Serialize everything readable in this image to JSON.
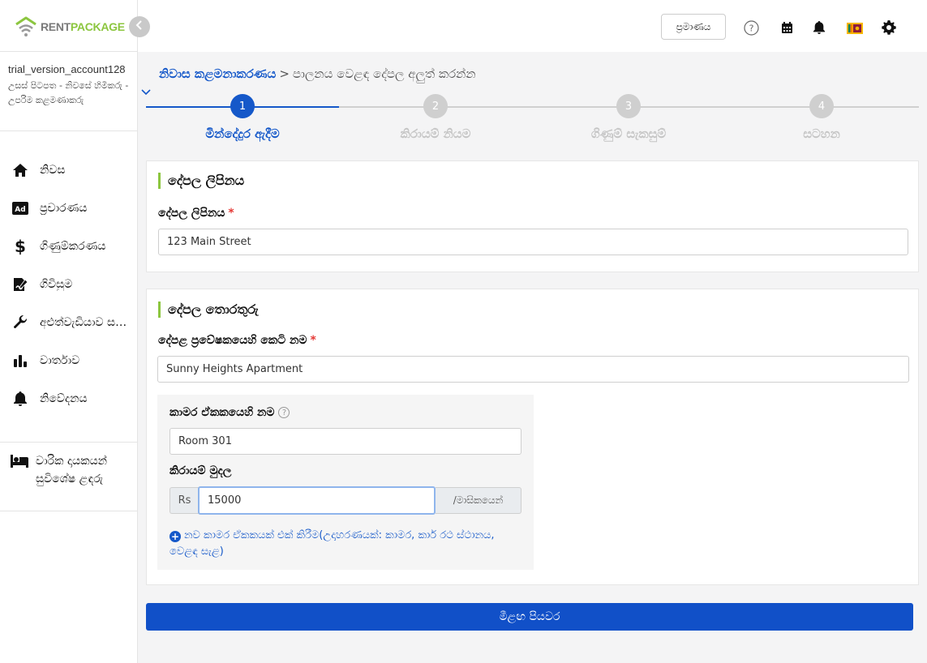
{
  "brand": {
    "rent": "RENT",
    "package": "PACKAGE",
    "accent": "#8cc63f",
    "primary": "#1558c9"
  },
  "header": {
    "auth_label": "ප්‍රමාණය",
    "icons": [
      "help-icon",
      "calendar-icon",
      "bell-icon",
      "flag-icon",
      "gear-icon"
    ]
  },
  "account": {
    "name": "trial_version_account128",
    "role": "උසස් පිටපත - නිවසේ හිමිකරු - උපරිම කළමණාකරු"
  },
  "sidebar": {
    "items": [
      {
        "label": "නිවස",
        "icon": "home-icon"
      },
      {
        "label": "ප්‍රචාරණය",
        "icon": "ad-icon"
      },
      {
        "label": "ගිණුම්කරණය",
        "icon": "dollar-icon"
      },
      {
        "label": "ගිවිසුම",
        "icon": "contract-icon"
      },
      {
        "label": "අළුත්වැඩියාව සහ නඩත්තුව",
        "icon": "wrench-icon"
      },
      {
        "label": "වාර්තාව",
        "icon": "chart-icon"
      },
      {
        "label": "නිවේදනය",
        "icon": "bell-icon"
      }
    ],
    "offers_label": "වාරික දායකයන් සුවිශේෂ ළඳරු"
  },
  "breadcrumb": {
    "parent": "නිවාස කළමනාකරණය",
    "separator": ">",
    "current": "පාලනය වෙළඳ දේපල අලුත් කරන්න"
  },
  "stepper": {
    "steps": [
      {
        "number": "1",
        "label": "මින්දේදුර ඇදීම"
      },
      {
        "number": "2",
        "label": "කිරායම් නියම"
      },
      {
        "number": "3",
        "label": "ගිණුම් සැකසුම්"
      },
      {
        "number": "4",
        "label": "සටහන"
      }
    ]
  },
  "address_card": {
    "title": "දේපල ලිපිනය",
    "field_label": "දේපල ලිපිනය",
    "required_mark": "*",
    "value": "123 Main Street"
  },
  "info_card": {
    "title": "දේපල තොරතුරු",
    "name_label": "දේපළ ප්‍රවේෂකයෙහි කෙටි නම",
    "required_mark": "*",
    "name_value": "Sunny Heights Apartment",
    "unit_name_label": "කාමර ඒකකයෙහි නම",
    "unit_help": "?",
    "unit_name_value": "Room 301",
    "rent_label": "කිරායම් මුදල",
    "currency": "Rs",
    "rent_value": "15000",
    "period": "/මාසිකයෙන්",
    "add_unit_label": "නව කාමර ඒකකයක් එක් කිරීම(උදාහරණයක්: කාමර, කාර් රථ ස්ථානය, වෙළඳ සැළ)"
  },
  "save_label": "මීළඟ පියවර"
}
